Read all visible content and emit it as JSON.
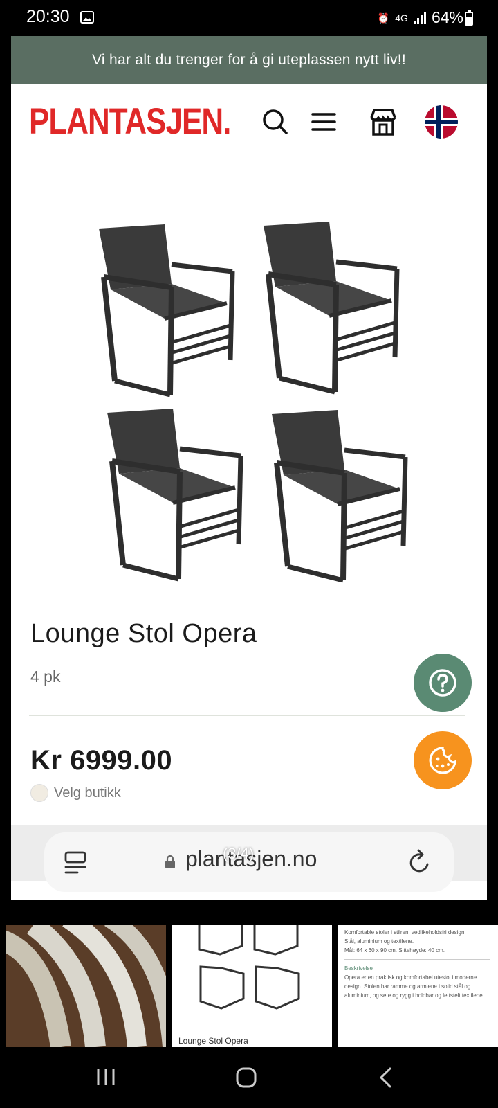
{
  "status_bar": {
    "time": "20:30",
    "network": "4G",
    "battery": "64%"
  },
  "promo": {
    "text": "Vi har alt du trenger for å gi uteplassen nytt liv!!"
  },
  "header": {
    "logo": "PLANTASJEN."
  },
  "product": {
    "title": "Lounge Stol Opera",
    "quantity": "4 pk",
    "price": "Kr 6999.00",
    "store_label": "Velg butikk"
  },
  "browser": {
    "url": "plantasjen.no",
    "pager": "(3/4)"
  },
  "thumbnails": {
    "caption": "Lounge Stol Opera",
    "details": [
      "Komfortable stoler i stilren, vedlikeholdsfri design.",
      "Stål, aluminium og textilene.",
      "Mål: 64 x 60 x 90 cm. Sittehøyde: 40 cm."
    ],
    "desc_heading": "Beskrivelse",
    "desc_text": "Opera er en praktisk og komfortabel utestol i moderne design. Stolen har ramme og armlene i solid stål og aluminium, og sete og rygg i holdbar og lettstelt textilene"
  },
  "colors": {
    "promo_bg": "#5a6e62",
    "logo_red": "#e02828",
    "help_fab": "#5a8a73",
    "cookie_fab": "#f7931e"
  }
}
